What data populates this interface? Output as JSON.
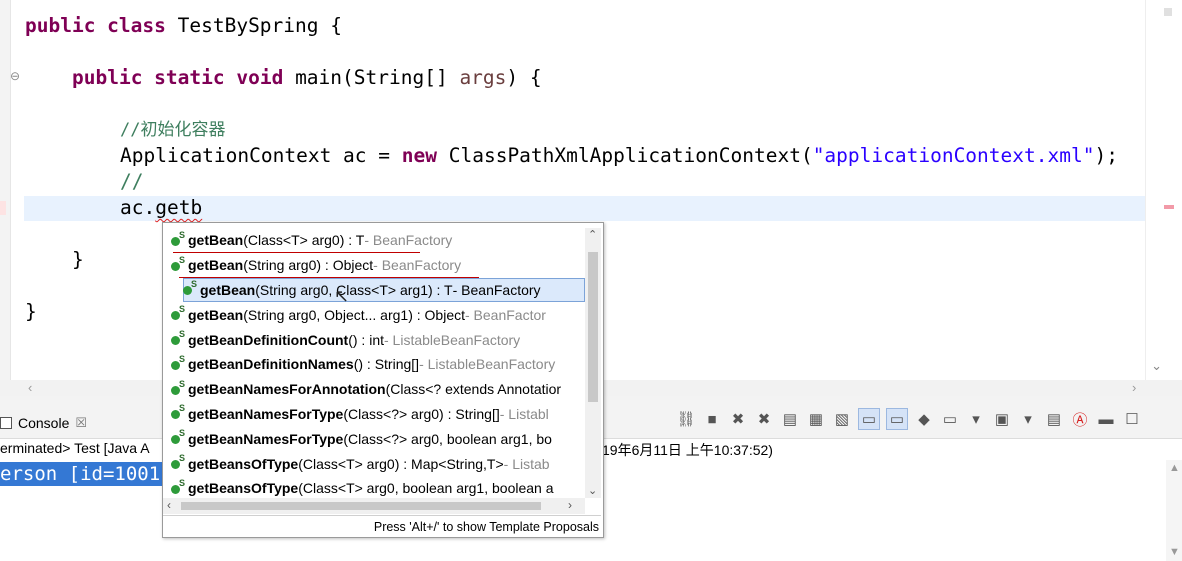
{
  "editor": {
    "lines": {
      "class_decl": {
        "kw": "public class",
        "rest": " TestBySpring {"
      },
      "main_decl": {
        "kw": "public static void",
        "rest": " main(String[] ",
        "param": "args",
        "end": ") {"
      },
      "comment1": "//初始化容器",
      "ctx_line": {
        "type": "ApplicationContext ac = ",
        "kw": "new",
        "ctor": " ClassPathXmlApplicationContext(",
        "str": "\"applicationContext.xml\"",
        "end": ");"
      },
      "comment2": "//",
      "current": {
        "prefix": "ac.",
        "typed": "getb"
      },
      "close_method": "}",
      "close_class": "}"
    }
  },
  "console": {
    "tab_label": "Console",
    "status_left": "erminated> Test [Java A",
    "status_right": "19年6月11日 上午10:37:52)",
    "output_text": "erson [id=1001"
  },
  "popup": {
    "proposals": [
      {
        "name": "getBean",
        "sig": "(Class<T> arg0) : T",
        "decl": " - BeanFactory"
      },
      {
        "name": "getBean",
        "sig": "(String arg0) : Object",
        "decl": " - BeanFactory"
      },
      {
        "name": "getBean",
        "sig": "(String arg0, Class<T> arg1) : T",
        "decl": " - BeanFactory",
        "selected": true
      },
      {
        "name": "getBean",
        "sig": "(String arg0, Object... arg1) : Object",
        "decl": " - BeanFactor"
      },
      {
        "name": "getBeanDefinitionCount",
        "sig": "() : int",
        "decl": " - ListableBeanFactory"
      },
      {
        "name": "getBeanDefinitionNames",
        "sig": "() : String[]",
        "decl": " - ListableBeanFactory"
      },
      {
        "name": "getBeanNamesForAnnotation",
        "sig": "(Class<? extends Annotatior",
        "decl": ""
      },
      {
        "name": "getBeanNamesForType",
        "sig": "(Class<?> arg0) : String[]",
        "decl": " - Listabl"
      },
      {
        "name": "getBeanNamesForType",
        "sig": "(Class<?> arg0, boolean arg1, bo",
        "decl": ""
      },
      {
        "name": "getBeansOfType",
        "sig": "(Class<T> arg0) : Map<String,T>",
        "decl": " - Listab"
      },
      {
        "name": "getBeansOfType",
        "sig": "(Class<T> arg0, boolean arg1, boolean a",
        "decl": ""
      }
    ],
    "status_text": "Press 'Alt+/' to show Template Proposals"
  },
  "icons": {
    "proposal_icon": "public-method-icon",
    "fold_icon": "collapse-minus-icon"
  }
}
